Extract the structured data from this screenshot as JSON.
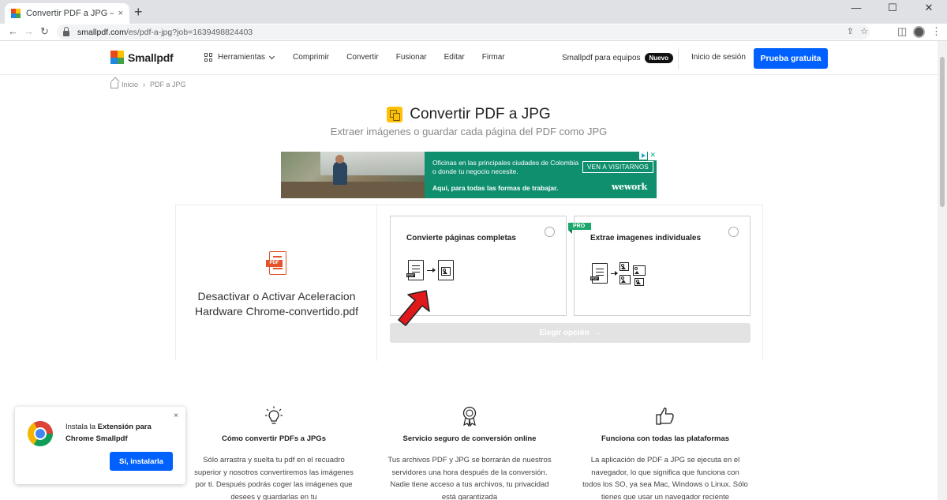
{
  "browser": {
    "tab_title": "Convertir PDF a JPG – Convierte",
    "tab_close": "×",
    "new_tab": "+",
    "window_minimize": "—",
    "window_maximize": "☐",
    "window_close": "✕",
    "url_host": "smallpdf.com",
    "url_path": "/es/pdf-a-jpg?job=1639498824403"
  },
  "header": {
    "logo_text": "Smallpdf",
    "tools_label": "Herramientas",
    "nav": [
      "Comprimir",
      "Convertir",
      "Fusionar",
      "Editar",
      "Firmar"
    ],
    "teams_label": "Smallpdf para equipos",
    "new_badge": "Nuevo",
    "login_label": "Inicio de sesión",
    "trial_button": "Prueba gratuita",
    "colors": {
      "accent": "#0061fe"
    }
  },
  "breadcrumb": {
    "home": "Inicio",
    "separator": "›",
    "current": "PDF a JPG"
  },
  "hero": {
    "title": "Convertir PDF a JPG",
    "subtitle": "Extraer imágenes o guardar cada página del PDF como JPG"
  },
  "ad": {
    "line1": "Oficinas en las principales ciudades de Colombia o donde tu negocio necesite.",
    "line2": "Aquí, para todas las formas de trabajar.",
    "cta": "VEN A VISITARNOS",
    "brand": "wework",
    "close": "✕"
  },
  "converter": {
    "file_name": "Desactivar o Activar Aceleracion Hardware Chrome-convertido.pdf",
    "pdf_label": "PDF",
    "option_full": "Convierte páginas completas",
    "option_images": "Extrae imagenes individuales",
    "pro_tag": "PRO",
    "choose_button": "Elegir opción",
    "choose_arrow": "→"
  },
  "features": [
    {
      "icon": "lightbulb-icon",
      "title": "Cómo convertir PDFs a JPGs",
      "text": "Sólo arrastra y suelta tu pdf en el recuadro superior y nosotros convertiremos las imágenes por ti. Después podrás coger las imágenes que desees y guardarlas en tu"
    },
    {
      "icon": "award-icon",
      "title": "Servicio seguro de conversión online",
      "text": "Tus archivos PDF y JPG se borrarán de nuestros servidores una hora después de la conversión. Nadie tiene acceso a tus archivos, tu privacidad está garantizada"
    },
    {
      "icon": "thumbs-up-icon",
      "title": "Funciona con todas las plataformas",
      "text": "La aplicación de PDF a JPG se ejecuta en el navegador, lo que significa que funciona con todos los SO, ya sea Mac, Windows o Linux. Sólo tienes que usar un navegador reciente"
    }
  ],
  "extension_popup": {
    "text_prefix": "Instala la ",
    "text_bold": "Extensión para Chrome Smallpdf",
    "button": "Sí, instalarla",
    "close": "×"
  }
}
